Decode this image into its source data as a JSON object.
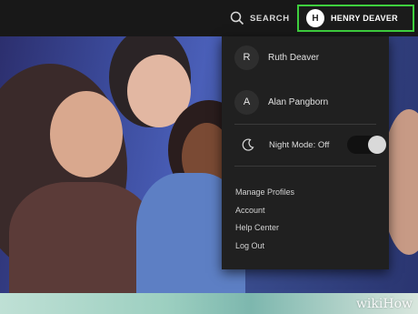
{
  "topbar": {
    "search_label": "SEARCH",
    "profile": {
      "initial": "H",
      "name": "HENRY DEAVER",
      "highlight_color": "#3ecf3e"
    }
  },
  "menu": {
    "profiles": [
      {
        "initial": "R",
        "name": "Ruth Deaver"
      },
      {
        "initial": "A",
        "name": "Alan Pangborn"
      }
    ],
    "night_mode": {
      "label": "Night Mode: Off",
      "enabled": false,
      "icon": "moon-icon"
    },
    "links": [
      "Manage Profiles",
      "Account",
      "Help Center",
      "Log Out"
    ]
  },
  "watermark": {
    "brand": "wikiHow"
  }
}
